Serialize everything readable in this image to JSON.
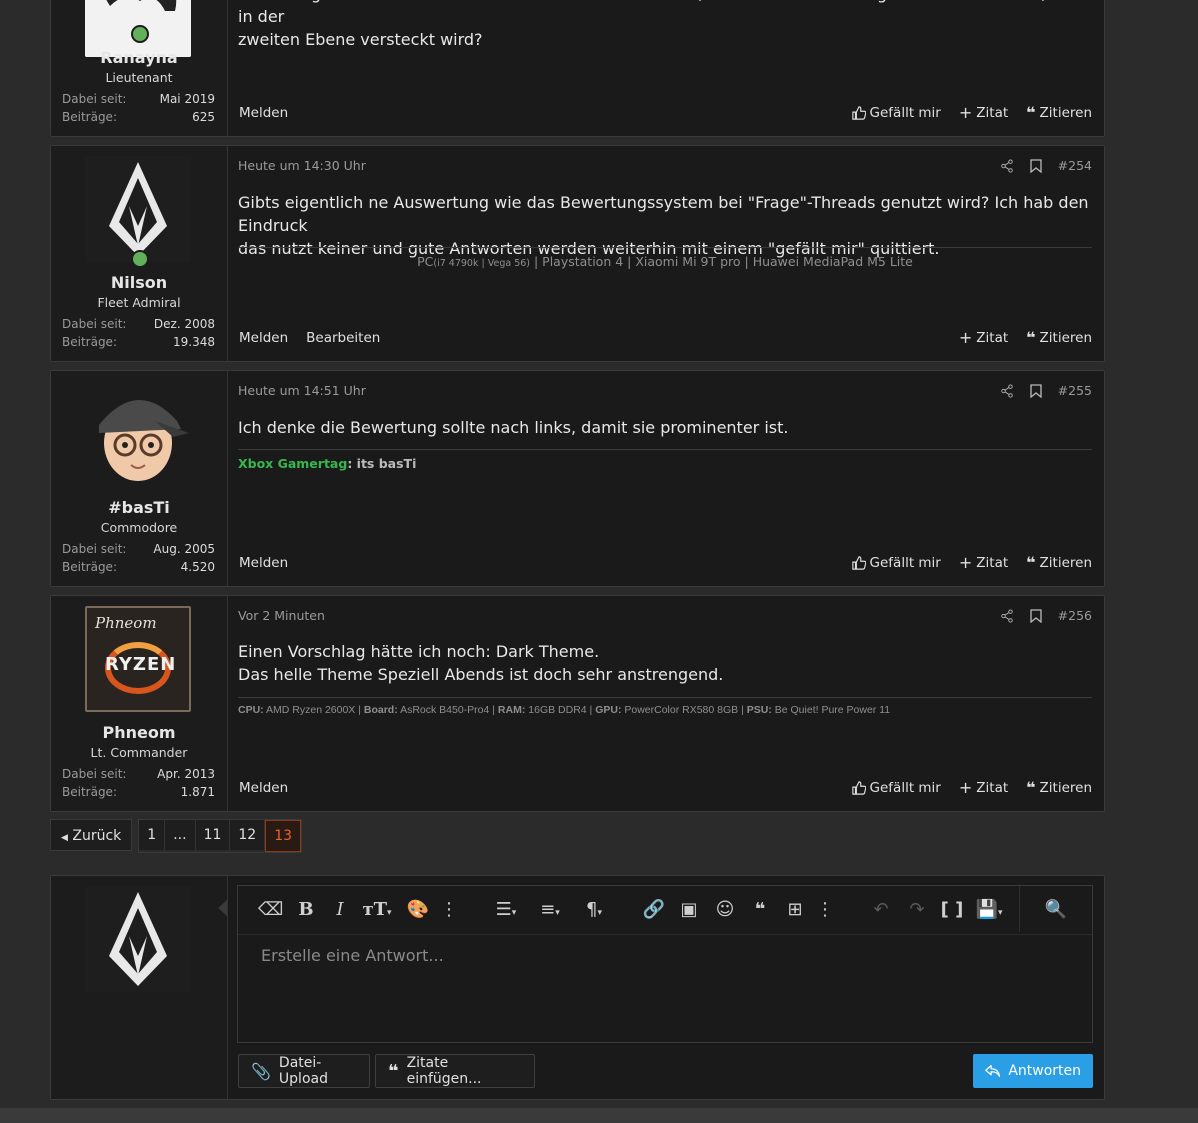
{
  "colors": {
    "accent": "#e8642c",
    "primary": "#2b9fe6",
    "online": "#63b05a",
    "gamertag": "#35b94d"
  },
  "labels": {
    "joined": "Dabei seit:",
    "posts": "Beiträge:",
    "report": "Melden",
    "edit": "Bearbeiten",
    "like": "Gefällt mir",
    "quote": "Zitat",
    "cite": "Zitieren"
  },
  "posts": [
    {
      "username": "Ranayna",
      "rank": "Lieutenant",
      "joined": "Mai 2019",
      "post_count": "625",
      "online": true,
      "message_lines": [
        "Ist es möglich es so einzustellen das der Button im Editor, zumindest in den Programmier Bereichen, nicht in der",
        "zweiten Ebene versteckt wird?"
      ]
    },
    {
      "username": "Nilson",
      "rank": "Fleet Admiral",
      "joined": "Dez. 2008",
      "post_count": "19.348",
      "online": true,
      "time": "Heute um 14:30 Uhr",
      "number": "#254",
      "message_lines": [
        "Gibts eigentlich ne Auswertung wie das Bewertungssystem bei \"Frage\"-Threads genutzt wird? Ich hab den Eindruck",
        "das nutzt keiner und gute Antworten werden weiterhin mit einem \"gefällt mir\" quittiert."
      ],
      "sig_pre": "PC",
      "sig_small": "(i7 4790k | Vega 56)",
      "sig_post": " | Playstation 4 | Xiaomi Mi 9T pro | Huawei MediaPad M5 Lite"
    },
    {
      "username": "#basTi",
      "rank": "Commodore",
      "joined": "Aug. 2005",
      "post_count": "4.520",
      "online": false,
      "time": "Heute um 14:51 Uhr",
      "number": "#255",
      "message_lines": [
        "Ich denke die Bewertung sollte nach links, damit sie prominenter ist."
      ],
      "sig_label": "Xbox Gamertag",
      "sig_value": ": its basTi"
    },
    {
      "username": "Phneom",
      "rank": "Lt. Commander",
      "joined": "Apr. 2013",
      "post_count": "1.871",
      "online": false,
      "time": "Vor 2 Minuten",
      "number": "#256",
      "message_lines": [
        "Einen Vorschlag hätte ich noch: Dark Theme.",
        "Das helle Theme Speziell Abends ist doch sehr anstrengend."
      ],
      "sig_parts": [
        [
          "CPU:",
          "AMD Ryzen 2600X"
        ],
        [
          "Board:",
          "AsRock B450-Pro4"
        ],
        [
          "RAM:",
          "16GB DDR4"
        ],
        [
          "GPU:",
          "PowerColor RX580 8GB"
        ],
        [
          "PSU:",
          "Be Quiet! Pure Power 11"
        ]
      ],
      "avatar_text": "Phneom",
      "avatar_logo": "RYZEN"
    }
  ],
  "pagination": {
    "prev": "Zurück",
    "pages": [
      "1",
      "...",
      "11",
      "12",
      "13"
    ],
    "current": "13"
  },
  "editor": {
    "placeholder": "Erstelle eine Antwort...",
    "upload_label": "Datei-Upload",
    "insert_quotes_label": "Zitate einfügen...",
    "submit_label": "Antworten"
  }
}
